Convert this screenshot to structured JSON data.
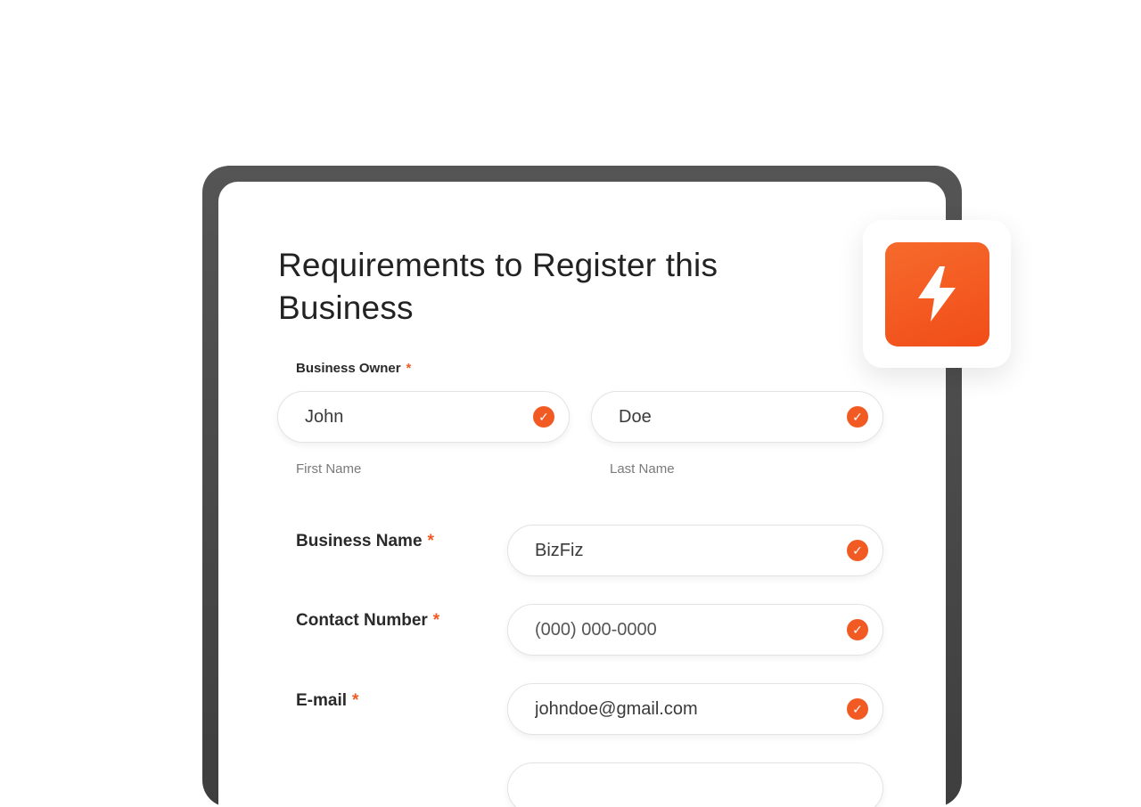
{
  "form": {
    "title": "Requirements to Register this Business",
    "business_owner": {
      "label": "Business Owner",
      "required_mark": "*",
      "first_name": {
        "value": "John",
        "sublabel": "First Name"
      },
      "last_name": {
        "value": "Doe",
        "sublabel": "Last Name"
      }
    },
    "business_name": {
      "label": "Business Name",
      "required_mark": "*",
      "value": "BizFiz"
    },
    "contact_number": {
      "label": "Contact Number",
      "required_mark": "*",
      "value": "(000) 000-0000"
    },
    "email": {
      "label": "E-mail",
      "required_mark": "*",
      "value": "johndoe@gmail.com"
    },
    "check_icon": "check-circle-icon"
  },
  "badge": {
    "icon": "lightning-bolt-icon"
  },
  "colors": {
    "accent": "#f15a22",
    "device_frame": "#484848",
    "text": "#222222",
    "sublabel": "#7a7a7a"
  }
}
